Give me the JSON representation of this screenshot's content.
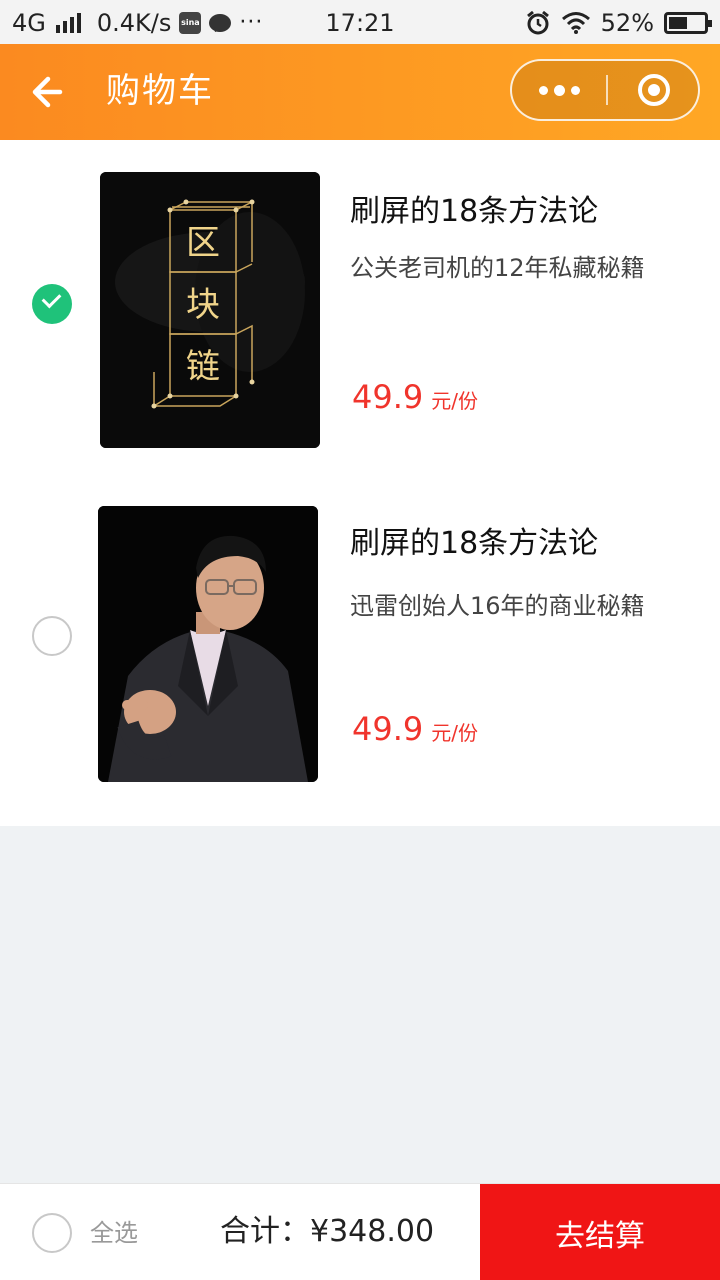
{
  "status_bar": {
    "network": "4G",
    "speed": "0.4K/s",
    "sina_label": "sina",
    "more_dots": "···",
    "time": "17:21",
    "battery": "52%",
    "battery_level": 0.52
  },
  "header": {
    "title": "购物车"
  },
  "items": [
    {
      "name": "刷屏的18条方法论",
      "desc": "公关老司机的12年私藏秘籍",
      "price": "49.9",
      "unit": "元/份",
      "selected": true,
      "cover_text": [
        "区",
        "块",
        "链"
      ]
    },
    {
      "name": "刷屏的18条方法论",
      "desc": "迅雷创始人16年的商业秘籍",
      "price": "49.9",
      "unit": "元/份",
      "selected": false
    }
  ],
  "bottom_bar": {
    "select_all_label": "全选",
    "total": "合计：¥348.00",
    "checkout_label": "去结算"
  },
  "colors": {
    "accent_orange": "#fb8a20",
    "price_red": "#f0342c",
    "checkout_red": "#f01515",
    "check_green": "#1fc27a"
  }
}
